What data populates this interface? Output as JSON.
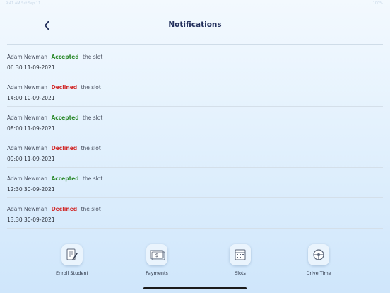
{
  "status_bar": {
    "left": "9:41 AM  Sat Sep 11",
    "right": "100%"
  },
  "header": {
    "title": "Notifications"
  },
  "notifications": [
    {
      "name": "Adam Newman",
      "status": "Accepted",
      "suffix": "the slot",
      "datetime": "06:30 11-09-2021"
    },
    {
      "name": "Adam Newman",
      "status": "Declined",
      "suffix": "the slot",
      "datetime": "14:00 10-09-2021"
    },
    {
      "name": "Adam Newman",
      "status": "Accepted",
      "suffix": "the slot",
      "datetime": "08:00 11-09-2021"
    },
    {
      "name": "Adam Newman",
      "status": "Declined",
      "suffix": "the slot",
      "datetime": "09:00 11-09-2021"
    },
    {
      "name": "Adam Newman",
      "status": "Accepted",
      "suffix": "the slot",
      "datetime": "12:30 30-09-2021"
    },
    {
      "name": "Adam Newman",
      "status": "Declined",
      "suffix": "the slot",
      "datetime": "13:30 30-09-2021"
    }
  ],
  "colors": {
    "accepted": "#2e8b2e",
    "declined": "#d12b2b",
    "title": "#23305c"
  },
  "tabs": [
    {
      "label": "Enroll Student",
      "icon": "document-pen-icon"
    },
    {
      "label": "Payments",
      "icon": "money-icon"
    },
    {
      "label": "Slots",
      "icon": "calendar-icon"
    },
    {
      "label": "Drive Time",
      "icon": "steering-wheel-icon"
    }
  ]
}
